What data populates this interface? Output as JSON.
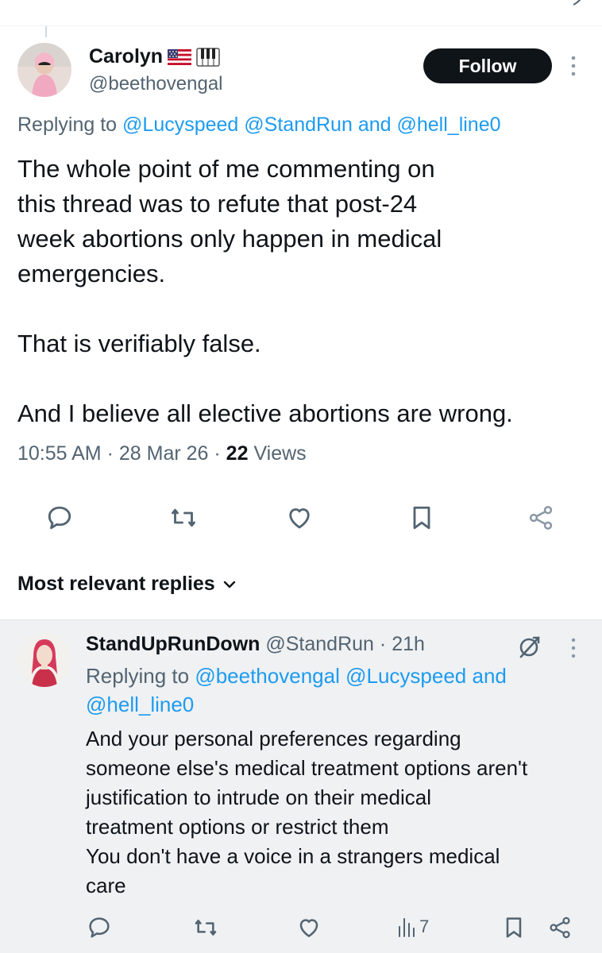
{
  "main_tweet": {
    "display_name": "Carolyn",
    "name_emojis": [
      "us-flag-emoji",
      "piano-keys-emoji"
    ],
    "handle": "@beethovengal",
    "follow_label": "Follow",
    "replying_prefix": "Replying to",
    "replying_to": [
      "@Lucyspeed",
      "@StandRun"
    ],
    "replying_and": "and",
    "replying_last": "@hell_line0",
    "body": [
      "The whole point of me commenting on\nthis thread was to refute that post-24\nweek abortions only happen in medical\nemergencies.",
      "That is verifiably false.",
      "And I believe all elective abortions are wrong."
    ],
    "time": "10:55 AM",
    "date": "28 Mar 26",
    "separator": "·",
    "views_count": "22",
    "views_label": "Views",
    "actions": [
      "reply-icon",
      "retweet-icon",
      "like-icon",
      "bookmark-icon",
      "share-icon"
    ]
  },
  "replies_sort": {
    "label": "Most relevant replies"
  },
  "reply": {
    "display_name": "StandUpRunDown",
    "handle": "@StandRun",
    "separator": "·",
    "time_ago": "21h",
    "replying_prefix": "Replying to",
    "replying_to": [
      "@beethovengal",
      "@Lucyspeed"
    ],
    "replying_and": "and",
    "replying_last": "@hell_line0",
    "body_lines": [
      "And your personal preferences regarding",
      "someone else's medical treatment options aren't",
      "justification to intrude on their medical",
      "treatment options or restrict them",
      "You don't have a voice in a strangers medical",
      "care"
    ],
    "views_count": "7"
  },
  "colors": {
    "link": "#1d9bf0",
    "secondary_text": "#536471",
    "primary_text": "#0f1419",
    "reply_background": "#eff1f3"
  }
}
